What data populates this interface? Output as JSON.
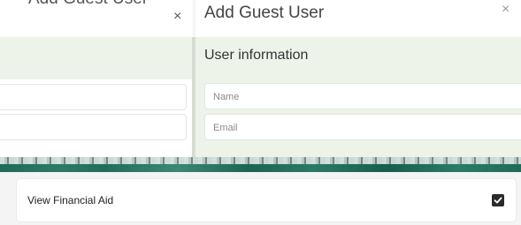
{
  "left_dialog": {
    "title": "Add Guest User",
    "close_glyph": "×"
  },
  "right_dialog": {
    "title": "Add Guest User",
    "close_glyph": "×",
    "section_title": "User information",
    "name_placeholder": "Name",
    "email_placeholder": "Email"
  },
  "permissions": {
    "view_financial_aid_label": "View Financial Aid",
    "view_financial_aid_checked": true
  },
  "icons": {
    "close": "close-icon",
    "check": "check-icon"
  },
  "colors": {
    "section_bg": "#eef3ea",
    "accent_strip": "#2a7a66",
    "checkbox": "#2b2b2b"
  }
}
